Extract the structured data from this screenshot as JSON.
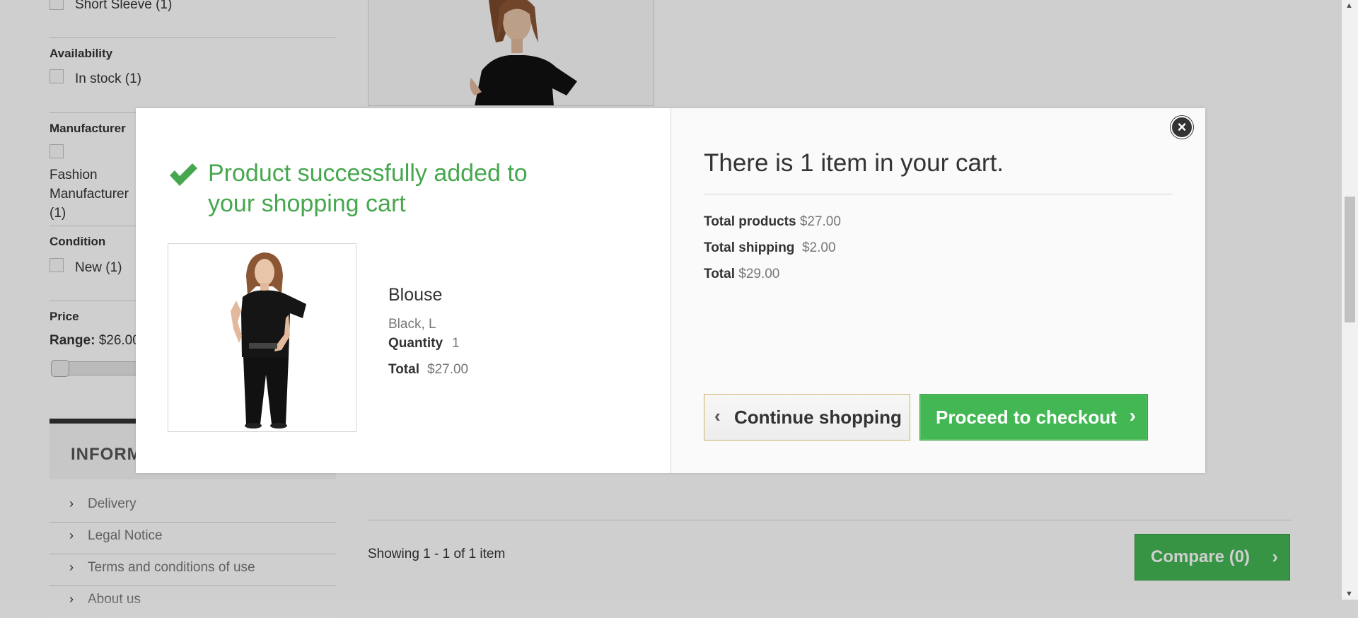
{
  "sidebar": {
    "style_item": {
      "label": "Short Sleeve (1)"
    },
    "availability": {
      "title": "Availability",
      "item": "In stock (1)"
    },
    "manufacturer": {
      "title": "Manufacturer",
      "item": "Fashion Manufacturer (1)"
    },
    "condition": {
      "title": "Condition",
      "item": "New (1)"
    },
    "price": {
      "title": "Price",
      "range_label": "Range:",
      "range_value": "$26.00 - $27.00"
    }
  },
  "information": {
    "title": "INFORMATION",
    "links": [
      {
        "label": "Delivery"
      },
      {
        "label": "Legal Notice"
      },
      {
        "label": "Terms and conditions of use"
      },
      {
        "label": "About us"
      }
    ]
  },
  "listing": {
    "showing": "Showing 1 - 1 of 1 item",
    "compare_label": "Compare (0)"
  },
  "modal": {
    "success_message": "Product successfully added to your shopping cart",
    "product": {
      "name": "Blouse",
      "attributes": "Black, L",
      "quantity_label": "Quantity",
      "quantity": "1",
      "total_label": "Total",
      "total": "$27.00"
    },
    "cart": {
      "heading": "There is 1 item in your cart.",
      "total_products_label": "Total products",
      "total_products": "$27.00",
      "total_shipping_label": "Total shipping",
      "total_shipping": "$2.00",
      "total_label": "Total",
      "total": "$29.00"
    },
    "continue_label": "Continue shopping",
    "checkout_label": "Proceed to checkout"
  },
  "colors": {
    "success_green": "#46a74e",
    "button_green": "#43b754"
  },
  "icons": {
    "check": "check-icon",
    "close": "close-icon",
    "chevron_left": "chevron-left-icon",
    "chevron_right": "chevron-right-icon"
  }
}
